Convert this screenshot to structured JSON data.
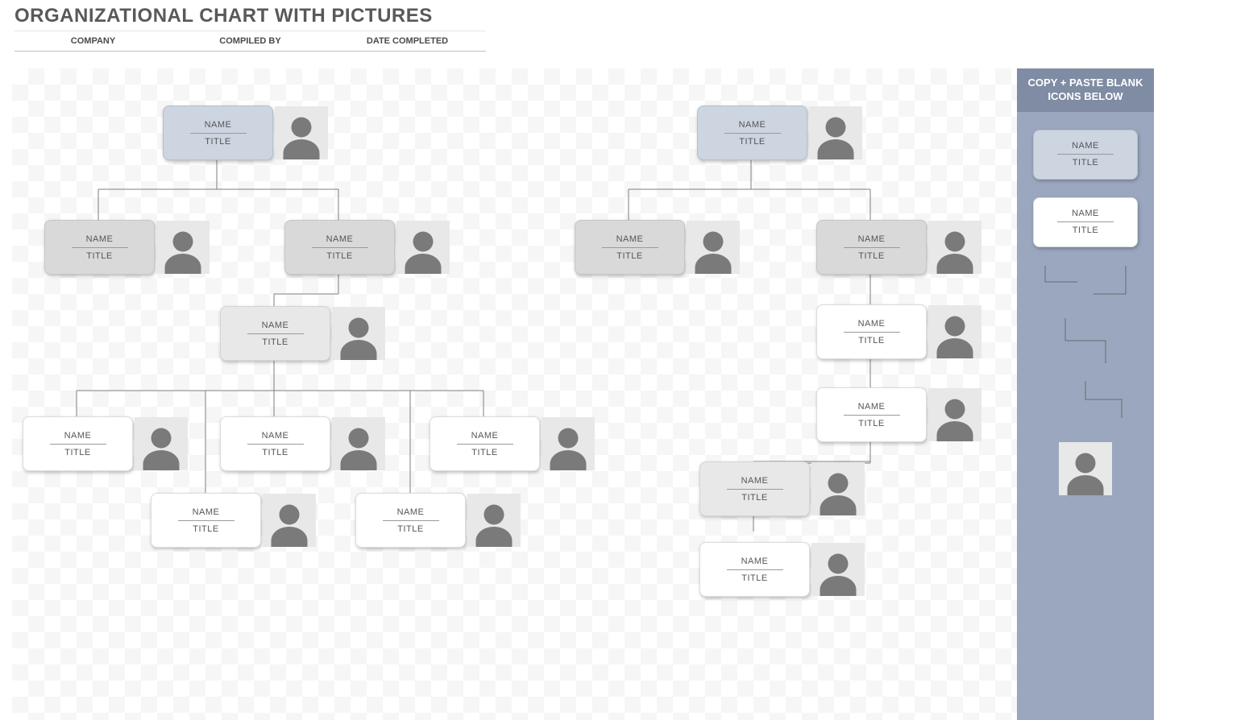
{
  "title": "ORGANIZATIONAL CHART WITH PICTURES",
  "header": {
    "company": "COMPANY",
    "compiled": "COMPILED BY",
    "date": "DATE COMPLETED"
  },
  "placeholder": {
    "name": "NAME",
    "title": "TITLE"
  },
  "sidebar": {
    "heading": "COPY + PASTE BLANK ICONS BELOW",
    "card_blue": {
      "name": "NAME",
      "title": "TITLE"
    },
    "card_white": {
      "name": "NAME",
      "title": "TITLE"
    }
  },
  "nodes": {
    "L_top": {
      "name": "NAME",
      "title": "TITLE"
    },
    "L_a": {
      "name": "NAME",
      "title": "TITLE"
    },
    "L_b": {
      "name": "NAME",
      "title": "TITLE"
    },
    "L_b1": {
      "name": "NAME",
      "title": "TITLE"
    },
    "L_c1": {
      "name": "NAME",
      "title": "TITLE"
    },
    "L_c2": {
      "name": "NAME",
      "title": "TITLE"
    },
    "L_c3": {
      "name": "NAME",
      "title": "TITLE"
    },
    "L_d1": {
      "name": "NAME",
      "title": "TITLE"
    },
    "L_d2": {
      "name": "NAME",
      "title": "TITLE"
    },
    "R_top": {
      "name": "NAME",
      "title": "TITLE"
    },
    "R_a": {
      "name": "NAME",
      "title": "TITLE"
    },
    "R_b": {
      "name": "NAME",
      "title": "TITLE"
    },
    "R_b1": {
      "name": "NAME",
      "title": "TITLE"
    },
    "R_b2": {
      "name": "NAME",
      "title": "TITLE"
    },
    "R_c": {
      "name": "NAME",
      "title": "TITLE"
    },
    "R_c1": {
      "name": "NAME",
      "title": "TITLE"
    }
  }
}
